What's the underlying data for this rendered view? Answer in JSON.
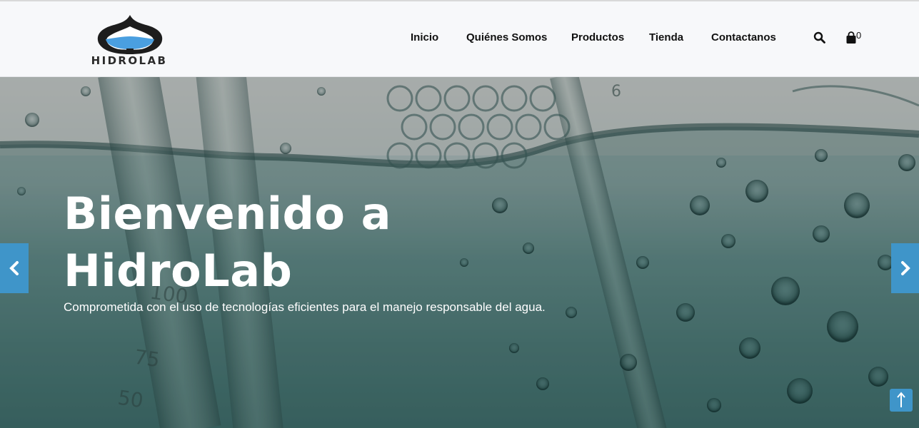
{
  "brand": {
    "name": "HIDROLAB",
    "colors": {
      "primary": "#3f95c9",
      "nav_bg": "#f7f8fa"
    }
  },
  "nav": {
    "items": [
      {
        "label": "Inicio"
      },
      {
        "label": "Quiénes Somos"
      },
      {
        "label": "Productos"
      },
      {
        "label": "Tienda"
      },
      {
        "label": "Contactanos"
      }
    ],
    "search_icon": "search-icon",
    "cart_icon": "shopping-bag-icon",
    "cart_count": "0"
  },
  "hero": {
    "title": "Bienvenido a HidroLab",
    "subtitle": "Comprometida con el uso de tecnologías eficientes para el manejo responsable del agua.",
    "scale_marks": [
      "100",
      "75",
      "50"
    ],
    "tube_mark": "6",
    "prev_icon": "chevron-left-icon",
    "next_icon": "chevron-right-icon"
  },
  "scroll_top_icon": "arrow-up-icon"
}
